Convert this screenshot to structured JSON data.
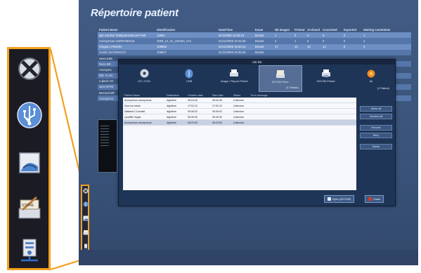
{
  "app": {
    "title": "Répertoire patient",
    "columns": [
      "Patient Name",
      "Identification",
      "Date/Time",
      "Exam",
      "Nb Images",
      "Printed",
      "Archived",
      "Converted",
      "Exported",
      "Waiting commitment"
    ],
    "rows": [
      {
        "name": "sph ASUNS   ToNEpoKoMtLeKA?HR",
        "id": "12684",
        "date": "01/1/2009 13:30:16",
        "exam": "Breast",
        "images": "1",
        "printed": "0",
        "archived": "0",
        "converted": "0",
        "exported": "0",
        "waiting": "1"
      },
      {
        "name": "Anonymous  ANONYMOUS",
        "id": "2009_12_01_100403_144",
        "date": "01/12/2009 10:44:28",
        "exam": "Breast",
        "images": "4",
        "printed": "1",
        "archived": "5",
        "converted": "0",
        "exported": "0",
        "waiting": "4"
      },
      {
        "name": "Vrogas  LYNSSIN",
        "id": "109993",
        "date": "01/12/2009 15:40:13",
        "exam": "Breast",
        "images": "17",
        "printed": "16",
        "archived": "15",
        "converted": "14",
        "exported": "0",
        "waiting": "0"
      },
      {
        "name": "Acosti  JALTOMACO",
        "id": "109917",
        "date": "01/12/2009 10:46:40",
        "exam": "Breast",
        "images": "",
        "printed": "",
        "archived": "",
        "converted": "",
        "exported": "",
        "waiting": ""
      },
      {
        "name": "Hoen  E5E",
        "id": "",
        "date": "",
        "exam": "",
        "images": "",
        "printed": "",
        "archived": "",
        "converted": "",
        "exported": "",
        "waiting": ""
      },
      {
        "name": "Resn  BR",
        "id": "",
        "date": "",
        "exam": "",
        "images": "",
        "printed": "",
        "archived": "",
        "converted": "",
        "exported": "",
        "waiting": ""
      },
      {
        "name": "Anonymo",
        "id": "",
        "date": "",
        "exam": "",
        "images": "",
        "printed": "",
        "archived": "",
        "converted": "",
        "exported": "",
        "waiting": ""
      },
      {
        "name": "INE  YLAN",
        "id": "",
        "date": "",
        "exam": "",
        "images": "",
        "printed": "",
        "archived": "",
        "converted": "",
        "exported": "",
        "waiting": ""
      },
      {
        "name": "Lubeck  HC",
        "id": "",
        "date": "",
        "exam": "",
        "images": "",
        "printed": "",
        "archived": "",
        "converted": "",
        "exported": "",
        "waiting": ""
      },
      {
        "name": "Jura  SPAN",
        "id": "",
        "date": "",
        "exam": "",
        "images": "",
        "printed": "",
        "archived": "",
        "converted": "",
        "exported": "",
        "waiting": ""
      },
      {
        "name": "Bernard  MF",
        "id": "",
        "date": "",
        "exam": "",
        "images": "",
        "printed": "",
        "archived": "",
        "converted": "",
        "exported": "",
        "waiting": ""
      },
      {
        "name": "Anonymou",
        "id": "",
        "date": "",
        "exam": "",
        "images": "",
        "printed": "",
        "archived": "",
        "converted": "",
        "exported": "",
        "waiting": ""
      }
    ]
  },
  "dialog": {
    "title": "Job list",
    "tabs": [
      {
        "label": "CD / DVD",
        "icon": "cd-icon",
        "note": ""
      },
      {
        "label": "USB",
        "icon": "usb-icon",
        "note": ""
      },
      {
        "label": "Image / Report Printer",
        "icon": "printer-icon",
        "note": ""
      },
      {
        "label": "DICOM Store",
        "icon": "dicom-store-icon",
        "note": "(1 Failure)"
      },
      {
        "label": "DICOM Printer",
        "icon": "dicom-printer-icon",
        "note": ""
      },
      {
        "label": "All",
        "icon": "all-jobs-icon",
        "note": "(1 Failure)"
      }
    ],
    "list_columns": [
      "Patient Name",
      "Destination",
      "Creation date",
      "Start date",
      "Status",
      "Error message"
    ],
    "list_rows": [
      {
        "name": "Anonymous  anonymous",
        "dest": "dig/dtore",
        "created": "05:04:40",
        "start": "05:04:40",
        "status": "Unknown",
        "error": ""
      },
      {
        "name": "Sourme  bacck",
        "dest": "dig/dtore",
        "created": "17:51:12",
        "start": "17:51:12",
        "status": "Unknown",
        "error": ""
      },
      {
        "name": "Nakandi  CLInvalid",
        "dest": "dig/dtore",
        "created": "05:06:02",
        "start": "05:06:02",
        "status": "Unknown",
        "error": ""
      },
      {
        "name": "Lyndffst  Vegas",
        "dest": "dig/dtore",
        "created": "05:26:30",
        "start": "05:26:30",
        "status": "Unknown",
        "error": ""
      },
      {
        "name": "Anonymous  anonymous",
        "dest": "dig/dtore",
        "created": "05:23:00",
        "start": "05:23:00",
        "status": "Unknown",
        "error": ""
      }
    ],
    "side_buttons": [
      "Select all",
      "Unselect all",
      "Resume",
      "Retry",
      "Delete"
    ],
    "footer": {
      "sync_label": "Sync (DICOM)",
      "close_label": "Close"
    }
  },
  "sidebar": {
    "items": [
      {
        "name": "cancel-icon"
      },
      {
        "name": "usb-icon"
      },
      {
        "name": "image-export-icon"
      },
      {
        "name": "dicom-store-icon"
      },
      {
        "name": "network-storage-icon"
      }
    ]
  },
  "colors": {
    "accent": "#f2a01f",
    "window": "#3e5880",
    "selection": "#6d8fc4",
    "close_button": "#d23d25"
  }
}
